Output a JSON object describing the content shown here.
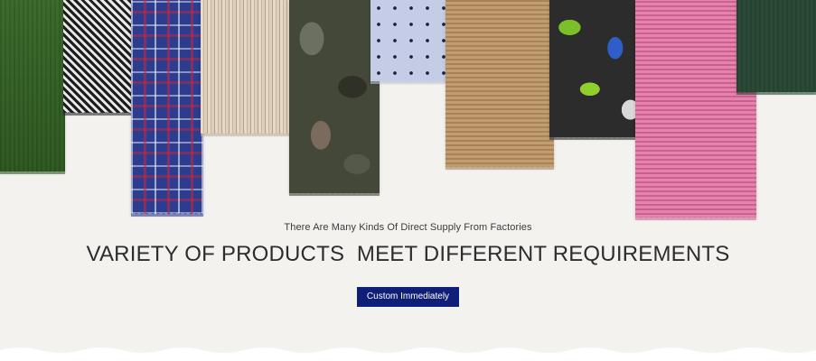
{
  "banner": {
    "subtitle": "There Are Many Kinds Of Direct Supply From Factories",
    "title": "VARIETY OF PRODUCTS  MEET DIFFERENT REQUIREMENTS",
    "cta_label": "Custom Immediately"
  },
  "colors": {
    "background": "#f3f2ef",
    "cta_background": "#0f1f78",
    "cta_text": "#ffffff",
    "title_text": "#2d2d2d"
  }
}
